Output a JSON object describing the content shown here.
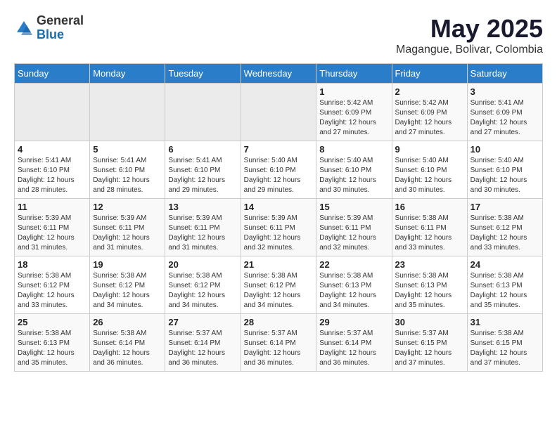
{
  "header": {
    "logo_line1": "General",
    "logo_line2": "Blue",
    "main_title": "May 2025",
    "sub_title": "Magangue, Bolivar, Colombia"
  },
  "weekdays": [
    "Sunday",
    "Monday",
    "Tuesday",
    "Wednesday",
    "Thursday",
    "Friday",
    "Saturday"
  ],
  "weeks": [
    [
      {
        "day": "",
        "info": ""
      },
      {
        "day": "",
        "info": ""
      },
      {
        "day": "",
        "info": ""
      },
      {
        "day": "",
        "info": ""
      },
      {
        "day": "1",
        "info": "Sunrise: 5:42 AM\nSunset: 6:09 PM\nDaylight: 12 hours and 27 minutes."
      },
      {
        "day": "2",
        "info": "Sunrise: 5:42 AM\nSunset: 6:09 PM\nDaylight: 12 hours and 27 minutes."
      },
      {
        "day": "3",
        "info": "Sunrise: 5:41 AM\nSunset: 6:09 PM\nDaylight: 12 hours and 27 minutes."
      }
    ],
    [
      {
        "day": "4",
        "info": "Sunrise: 5:41 AM\nSunset: 6:10 PM\nDaylight: 12 hours and 28 minutes."
      },
      {
        "day": "5",
        "info": "Sunrise: 5:41 AM\nSunset: 6:10 PM\nDaylight: 12 hours and 28 minutes."
      },
      {
        "day": "6",
        "info": "Sunrise: 5:41 AM\nSunset: 6:10 PM\nDaylight: 12 hours and 29 minutes."
      },
      {
        "day": "7",
        "info": "Sunrise: 5:40 AM\nSunset: 6:10 PM\nDaylight: 12 hours and 29 minutes."
      },
      {
        "day": "8",
        "info": "Sunrise: 5:40 AM\nSunset: 6:10 PM\nDaylight: 12 hours and 30 minutes."
      },
      {
        "day": "9",
        "info": "Sunrise: 5:40 AM\nSunset: 6:10 PM\nDaylight: 12 hours and 30 minutes."
      },
      {
        "day": "10",
        "info": "Sunrise: 5:40 AM\nSunset: 6:10 PM\nDaylight: 12 hours and 30 minutes."
      }
    ],
    [
      {
        "day": "11",
        "info": "Sunrise: 5:39 AM\nSunset: 6:11 PM\nDaylight: 12 hours and 31 minutes."
      },
      {
        "day": "12",
        "info": "Sunrise: 5:39 AM\nSunset: 6:11 PM\nDaylight: 12 hours and 31 minutes."
      },
      {
        "day": "13",
        "info": "Sunrise: 5:39 AM\nSunset: 6:11 PM\nDaylight: 12 hours and 31 minutes."
      },
      {
        "day": "14",
        "info": "Sunrise: 5:39 AM\nSunset: 6:11 PM\nDaylight: 12 hours and 32 minutes."
      },
      {
        "day": "15",
        "info": "Sunrise: 5:39 AM\nSunset: 6:11 PM\nDaylight: 12 hours and 32 minutes."
      },
      {
        "day": "16",
        "info": "Sunrise: 5:38 AM\nSunset: 6:11 PM\nDaylight: 12 hours and 33 minutes."
      },
      {
        "day": "17",
        "info": "Sunrise: 5:38 AM\nSunset: 6:12 PM\nDaylight: 12 hours and 33 minutes."
      }
    ],
    [
      {
        "day": "18",
        "info": "Sunrise: 5:38 AM\nSunset: 6:12 PM\nDaylight: 12 hours and 33 minutes."
      },
      {
        "day": "19",
        "info": "Sunrise: 5:38 AM\nSunset: 6:12 PM\nDaylight: 12 hours and 34 minutes."
      },
      {
        "day": "20",
        "info": "Sunrise: 5:38 AM\nSunset: 6:12 PM\nDaylight: 12 hours and 34 minutes."
      },
      {
        "day": "21",
        "info": "Sunrise: 5:38 AM\nSunset: 6:12 PM\nDaylight: 12 hours and 34 minutes."
      },
      {
        "day": "22",
        "info": "Sunrise: 5:38 AM\nSunset: 6:13 PM\nDaylight: 12 hours and 34 minutes."
      },
      {
        "day": "23",
        "info": "Sunrise: 5:38 AM\nSunset: 6:13 PM\nDaylight: 12 hours and 35 minutes."
      },
      {
        "day": "24",
        "info": "Sunrise: 5:38 AM\nSunset: 6:13 PM\nDaylight: 12 hours and 35 minutes."
      }
    ],
    [
      {
        "day": "25",
        "info": "Sunrise: 5:38 AM\nSunset: 6:13 PM\nDaylight: 12 hours and 35 minutes."
      },
      {
        "day": "26",
        "info": "Sunrise: 5:38 AM\nSunset: 6:14 PM\nDaylight: 12 hours and 36 minutes."
      },
      {
        "day": "27",
        "info": "Sunrise: 5:37 AM\nSunset: 6:14 PM\nDaylight: 12 hours and 36 minutes."
      },
      {
        "day": "28",
        "info": "Sunrise: 5:37 AM\nSunset: 6:14 PM\nDaylight: 12 hours and 36 minutes."
      },
      {
        "day": "29",
        "info": "Sunrise: 5:37 AM\nSunset: 6:14 PM\nDaylight: 12 hours and 36 minutes."
      },
      {
        "day": "30",
        "info": "Sunrise: 5:37 AM\nSunset: 6:15 PM\nDaylight: 12 hours and 37 minutes."
      },
      {
        "day": "31",
        "info": "Sunrise: 5:38 AM\nSunset: 6:15 PM\nDaylight: 12 hours and 37 minutes."
      }
    ]
  ]
}
